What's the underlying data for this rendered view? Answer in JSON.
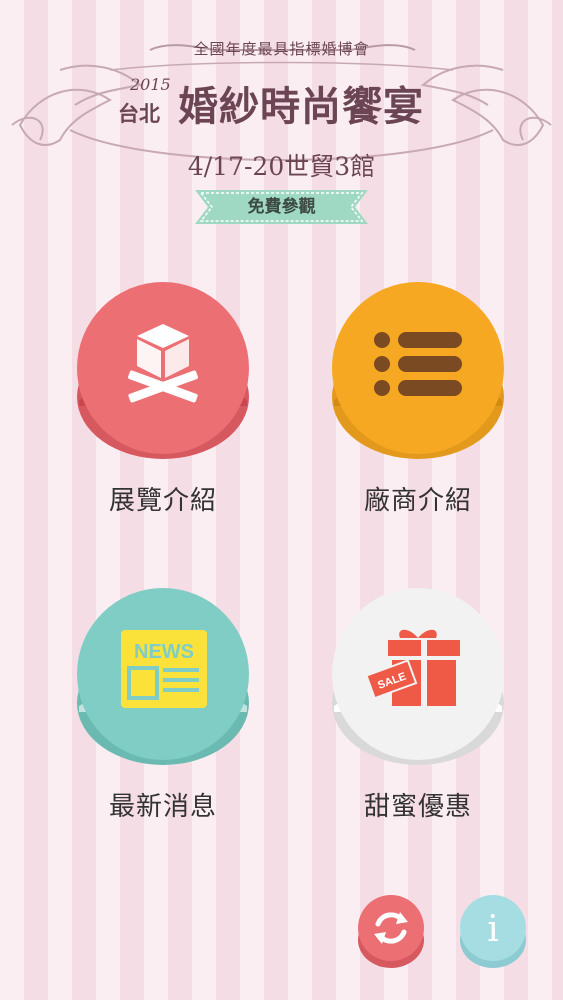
{
  "header": {
    "subtitle": "全國年度最具指標婚博會",
    "year": "2015",
    "city": "台北",
    "title": "婚紗時尚饗宴",
    "dates": "4/17-20世貿3館",
    "badge": "免費參觀"
  },
  "menu": [
    {
      "label": "展覽介紹",
      "icon": "box-stand-icon",
      "color": "#ec6f74"
    },
    {
      "label": "廠商介紹",
      "icon": "list-icon",
      "color": "#f7a823"
    },
    {
      "label": "最新消息",
      "icon": "newspaper-icon",
      "news_text": "NEWS",
      "color": "#7fcdc4"
    },
    {
      "label": "甜蜜優惠",
      "icon": "gift-sale-icon",
      "sale_text": "SALE",
      "color": "#f2f2f2"
    }
  ],
  "bottom_buttons": [
    {
      "icon": "refresh-icon",
      "color": "#ec6f74"
    },
    {
      "icon": "info-icon",
      "label": "i",
      "color": "#a6dde3"
    }
  ],
  "colors": {
    "text_dark": "#6b4553",
    "ribbon": "#9fd9c4",
    "label": "#333333"
  }
}
